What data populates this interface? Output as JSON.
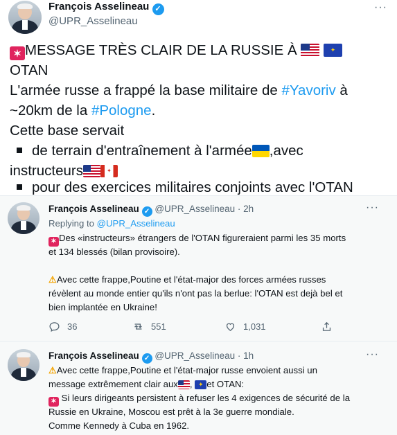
{
  "main_tweet": {
    "author_name": "François Asselineau",
    "author_handle": "@UPR_Asselineau",
    "more_label": "···",
    "line1_text": "MESSAGE TRÈS CLAIR DE LA RUSSIE À ",
    "line2_text": "OTAN",
    "line3_prefix": "L'armée russe a frappé la base militaire de ",
    "line3_link": "#Yavoriv",
    "line3_suffix": " à",
    "line4_prefix": "~20km de la ",
    "line4_link": "#Pologne",
    "line4_suffix": ".",
    "line5_text": "Cette base servait",
    "line6_text": "de terrain d'entraînement à l'armée",
    "line6_suffix": ",avec",
    "line7_text": "instructeurs",
    "line8_text": "pour des exercices militaires conjoints avec l'OTAN"
  },
  "reply1": {
    "author_name": "François Asselineau",
    "author_handle": "@UPR_Asselineau",
    "time": "· 2h",
    "more_label": "···",
    "replying_prefix": "Replying to ",
    "replying_handle": "@UPR_Asselineau",
    "p1_line1": "Des «instructeurs» étrangers de l'OTAN figureraient parmi les 35 morts",
    "p1_line2": "et 134 blessés (bilan provisoire).",
    "p2_line1": "Avec cette frappe,Poutine et l'état-major des forces armées russes",
    "p2_line2": "révèlent au monde entier qu'ils n'ont pas la berlue: l'OTAN est dejà bel et",
    "p2_line3": "bien implantée en Ukraine!",
    "reply_count": "36",
    "retweet_count": "551",
    "like_count": "1,031"
  },
  "reply2": {
    "author_name": "François Asselineau",
    "author_handle": "@UPR_Asselineau",
    "time": "· 1h",
    "more_label": "···",
    "l1": "Avec cette frappe,Poutine et l'état-major russe envoient aussi un",
    "l2_prefix": "message extrêmement clair aux",
    "l2_mid": ", ",
    "l2_suffix": "et OTAN:",
    "l3": "Si leurs dirigeants persistent à refuser les 4 exigences de sécurité de la",
    "l4": "Russie en Ukraine, Moscou est prêt à la 3e guerre mondiale.",
    "l5": "Comme Kennedy à Cuba en 1962."
  },
  "colors": {
    "link": "#1d9bf0",
    "muted": "#536471",
    "verified": "#1d9bf0",
    "alert": "#e0245e"
  },
  "icons": [
    "verified-badge-icon",
    "siren-icon",
    "warning-icon",
    "reply-icon",
    "retweet-icon",
    "like-icon",
    "share-icon",
    "more-icon"
  ]
}
